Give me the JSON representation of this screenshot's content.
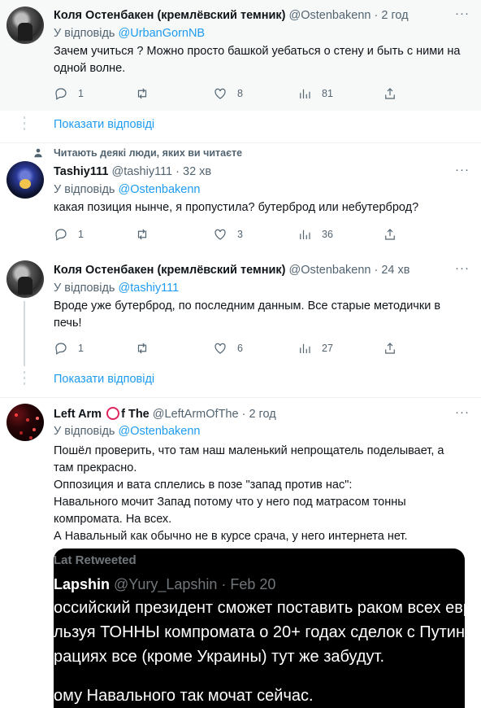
{
  "tweets": [
    {
      "name": "Коля Остенбакен (кремлёвский темник)",
      "handle": "@Ostenbakenn",
      "time": "· 2 год",
      "reply_prefix": "У відповідь",
      "reply_to": "@UrbanGornNB",
      "text": "Зачем учиться ? Можно просто башкой уебаться о стену и быть с ними на одной волне.",
      "replies": "1",
      "retweets": "",
      "likes": "8",
      "views": "81"
    },
    {
      "name": "Tashiy111",
      "handle": "@tashiy111",
      "time": "· 32 хв",
      "reply_prefix": "У відповідь",
      "reply_to": "@Ostenbakenn",
      "text": "какая позиция нынче, я пропустила? бутерброд или небутерброд?",
      "replies": "1",
      "retweets": "",
      "likes": "3",
      "views": "36"
    },
    {
      "name": "Коля Остенбакен (кремлёвский темник)",
      "handle": "@Ostenbakenn",
      "time": "· 24 хв",
      "reply_prefix": "У відповідь",
      "reply_to": "@tashiy111",
      "text": "Вроде уже бутерброд, по последним данным. Все старые методички в печь!",
      "replies": "1",
      "retweets": "",
      "likes": "6",
      "views": "27"
    },
    {
      "name_part1": "Left Arm",
      "name_part2": "f The",
      "handle": "@LeftArmOfThe",
      "time": "· 2 год",
      "reply_prefix": "У відповідь",
      "reply_to": "@Ostenbakenn",
      "text_lines": [
        "Пошёл проверить, что там наш маленький непрощатель поделывает, а",
        "там прекрасно.",
        "Оппозиция и вата сплелись в позе \"запад против нас\":",
        "Навального мочит Запад потому что у него под матрасом тонны",
        "компромата. На всех.",
        "А Навальный как обычно не в курсе срача, у него интернета нет."
      ]
    }
  ],
  "show_replies": "Показати відповіді",
  "social_context": "Читають деякі люди, яких ви читаєте",
  "more_glyph": "···",
  "embedded_image": {
    "retweeted_label": "Lat Retweeted",
    "author": "Lapshin",
    "author_handle": "@Yury_Lapshin · Feb 20",
    "lines": [
      "оссийский президент сможет поставить раком всех евр",
      "льзуя ТОННЫ компромата о 20+ годах сделок с Путины",
      "рациях все (кроме Украины) тут же забудут.",
      "ому Навального так мочат сейчас."
    ]
  },
  "colors": {
    "accent": "#1d9bf0",
    "muted": "#536471",
    "ring": "#e0245e"
  }
}
